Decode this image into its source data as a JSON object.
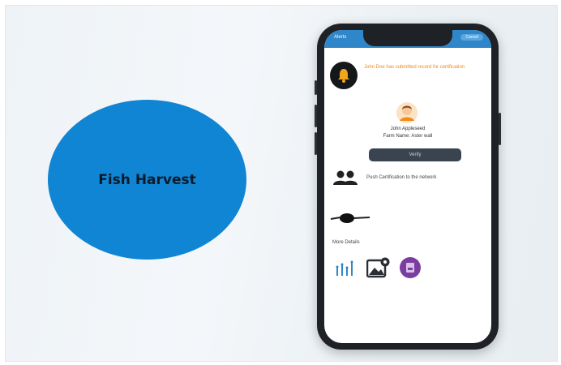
{
  "slide": {
    "ellipse_label": "Fish Harvest",
    "ellipse_color": "#0f85d3"
  },
  "phone": {
    "topbar": {
      "left_label": "Alerts",
      "right_label": "Cancel",
      "color": "#2f86c9"
    },
    "notification": {
      "icon": "bell-icon",
      "text": "John Doe has submitted record for certification"
    },
    "applicant": {
      "icon": "person-avatar-icon",
      "name": "John Appleseed",
      "farm": "Farm Name: Aster wall"
    },
    "verify_button": "Verify",
    "push": {
      "icon": "group-icon",
      "text": "Push Certification to the network"
    },
    "more_details_label": "More Details",
    "detail_icons": [
      "bar-chart-icon",
      "gallery-icon",
      "document-icon"
    ]
  }
}
